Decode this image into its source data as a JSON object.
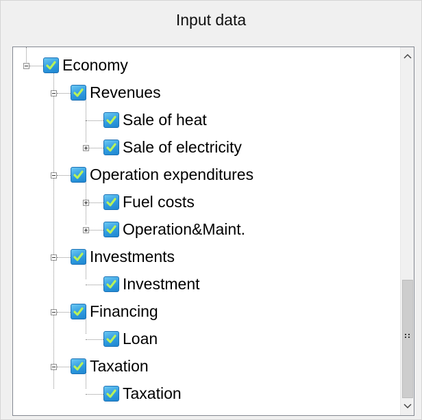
{
  "panel": {
    "title": "Input data"
  },
  "tree": {
    "items": [
      {
        "label": "Economy",
        "level": 0,
        "expander": "minus",
        "checked": true
      },
      {
        "label": "Revenues",
        "level": 1,
        "expander": "minus",
        "checked": true
      },
      {
        "label": "Sale of heat",
        "level": 2,
        "expander": "none",
        "checked": true
      },
      {
        "label": "Sale of electricity",
        "level": 2,
        "expander": "plus",
        "checked": true
      },
      {
        "label": "Operation expenditures",
        "level": 1,
        "expander": "minus",
        "checked": true
      },
      {
        "label": "Fuel costs",
        "level": 2,
        "expander": "plus",
        "checked": true
      },
      {
        "label": "Operation&Maint.",
        "level": 2,
        "expander": "plus",
        "checked": true
      },
      {
        "label": "Investments",
        "level": 1,
        "expander": "minus",
        "checked": true
      },
      {
        "label": "Investment",
        "level": 2,
        "expander": "none",
        "checked": true
      },
      {
        "label": "Financing",
        "level": 1,
        "expander": "minus",
        "checked": true
      },
      {
        "label": "Loan",
        "level": 2,
        "expander": "none",
        "checked": true
      },
      {
        "label": "Taxation",
        "level": 1,
        "expander": "minus",
        "checked": true
      },
      {
        "label": "Taxation",
        "level": 2,
        "expander": "none",
        "checked": true
      }
    ]
  },
  "scrollbar": {
    "up_icon": "chevron-up-icon",
    "down_icon": "chevron-down-icon",
    "position": 0.82
  },
  "colors": {
    "checkbox": "#2f9be0",
    "check": "#b8f25a",
    "tree_line": "#8a8a8a"
  }
}
